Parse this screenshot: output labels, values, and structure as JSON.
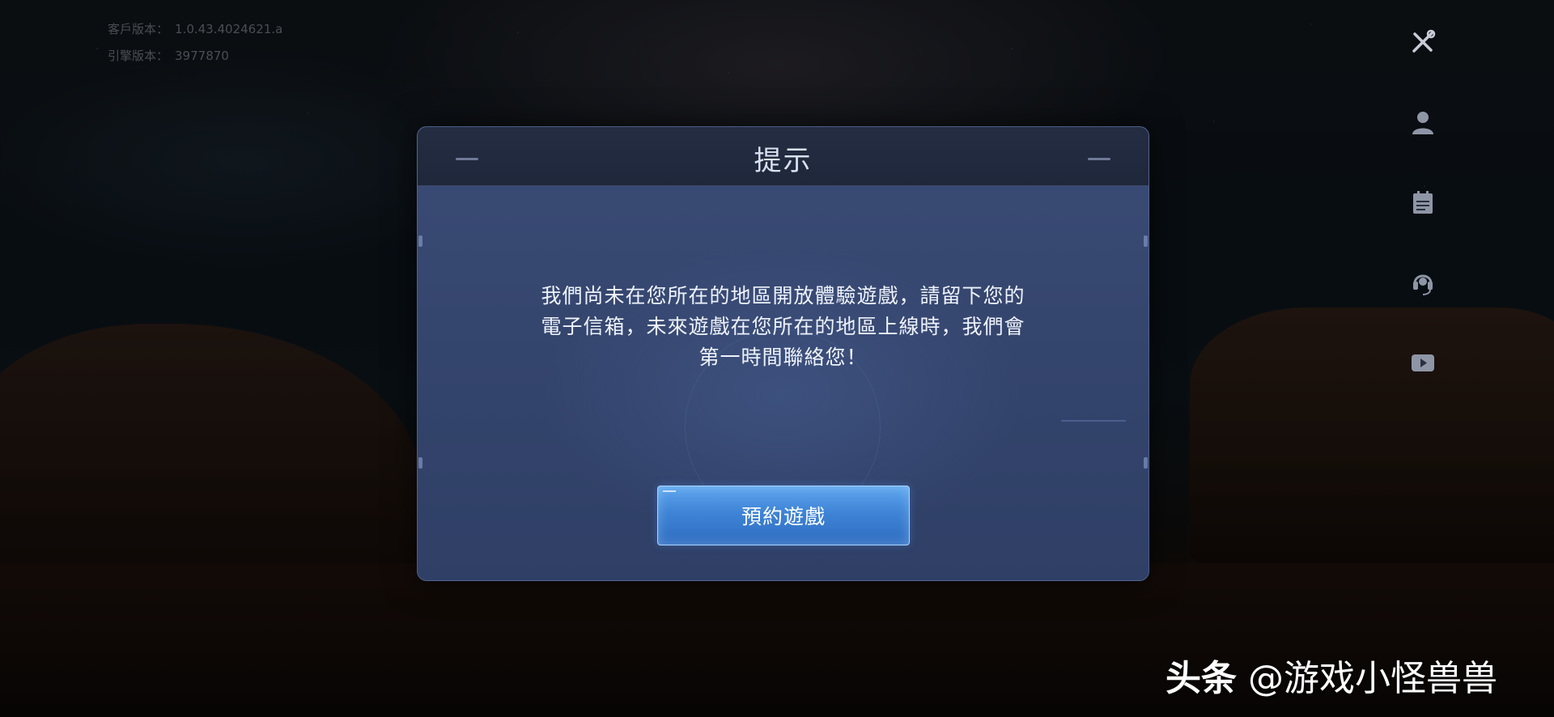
{
  "version_info": {
    "client_label": "客戶版本：",
    "client_version": "1.0.43.4024621.a",
    "engine_label": "引擎版本：",
    "engine_version": "3977870"
  },
  "side_icons": [
    {
      "name": "tools-icon"
    },
    {
      "name": "profile-icon"
    },
    {
      "name": "calendar-icon"
    },
    {
      "name": "headset-icon"
    },
    {
      "name": "video-icon"
    }
  ],
  "dialog": {
    "title": "提示",
    "message_lines": [
      "我們尚未在您所在的地區開放體驗遊戲，請留下您的",
      "電子信箱，未來遊戲在您所在的地區上線時，我們會",
      "第一時間聯絡您！"
    ],
    "button_label": "預約遊戲"
  },
  "watermark": {
    "brand": "头条",
    "handle": "@游戏小怪兽兽"
  }
}
